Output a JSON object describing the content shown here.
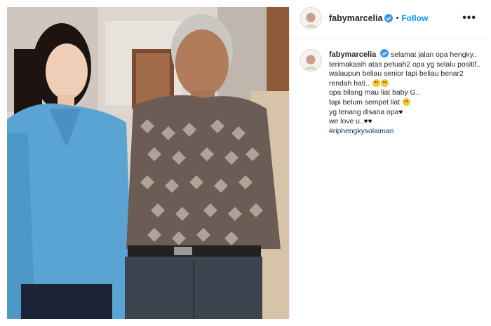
{
  "post": {
    "username": "fabymarcelia",
    "follow_label": "Follow",
    "separator": "•",
    "more_label": "•••"
  },
  "caption": {
    "username": "fabymarcelia",
    "lines": [
      "selamat jalan opa hengky..",
      "terimakasih atas petuah2 opa yg selalu positif.. walaupun beliau senior tapi beliau benar2 rendah hati..",
      "opa bilang mau liat baby G..",
      "tapi belum sempet liat",
      "yg tenang disana opa",
      "we love u.."
    ],
    "heart": "♥",
    "hashtag": "#riphengkysolaiman"
  },
  "icons": {
    "verified": "verified-badge-icon",
    "more": "more-options-icon",
    "emoji": "crying-face-emoji",
    "heart": "black-heart-emoji"
  },
  "colors": {
    "follow": "#0095f6",
    "hashtag": "#00376b",
    "verified": "#3897f0",
    "text": "#262626"
  }
}
